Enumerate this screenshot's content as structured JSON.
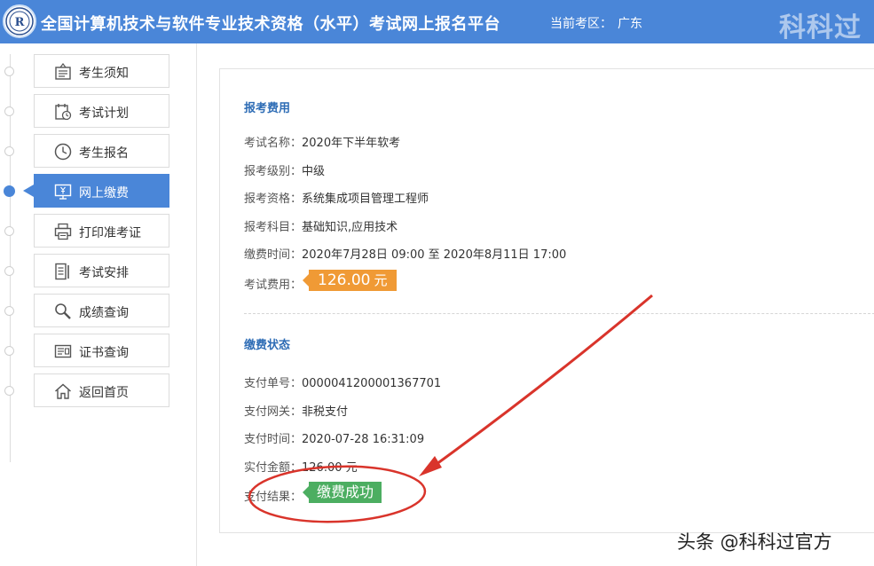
{
  "header": {
    "title": "全国计算机技术与软件专业技术资格（水平）考试网上报名平台",
    "region_label": "当前考区：",
    "region_value": "广东",
    "watermark": "科科过"
  },
  "sidebar": {
    "items": [
      {
        "label": "考生须知",
        "icon": "notice-board-icon",
        "active": false
      },
      {
        "label": "考试计划",
        "icon": "calendar-clock-icon",
        "active": false
      },
      {
        "label": "考生报名",
        "icon": "clock-icon",
        "active": false
      },
      {
        "label": "网上缴费",
        "icon": "monitor-yen-icon",
        "active": true
      },
      {
        "label": "打印准考证",
        "icon": "printer-icon",
        "active": false
      },
      {
        "label": "考试安排",
        "icon": "document-list-icon",
        "active": false
      },
      {
        "label": "成绩查询",
        "icon": "magnifier-icon",
        "active": false
      },
      {
        "label": "证书查询",
        "icon": "certificate-icon",
        "active": false
      },
      {
        "label": "返回首页",
        "icon": "home-icon",
        "active": false
      }
    ]
  },
  "fees": {
    "title": "报考费用",
    "exam_name_label": "考试名称：",
    "exam_name": "2020年下半年软考",
    "level_label": "报考级别：",
    "level": "中级",
    "qualification_label": "报考资格：",
    "qualification": "系统集成项目管理工程师",
    "subjects_label": "报考科目：",
    "subjects": "基础知识,应用技术",
    "period_label": "缴费时间：",
    "period": "2020年7月28日 09:00 至 2020年8月11日 17:00",
    "fee_label": "考试费用：",
    "fee_amount": "126.00",
    "fee_unit": "元"
  },
  "payment": {
    "title": "缴费状态",
    "order_label": "支付单号：",
    "order_no": "0000041200001367701",
    "gateway_label": "支付网关：",
    "gateway": "非税支付",
    "time_label": "支付时间：",
    "time": "2020-07-28 16:31:09",
    "amount_label": "实付金额：",
    "amount": "126.00 元",
    "result_label": "支付结果：",
    "result": "缴费成功"
  },
  "watermark_bottom": "头条 @科科过官方",
  "colors": {
    "header_bg": "#4a86d8",
    "fee_badge": "#f09a35",
    "success_badge": "#4cae61",
    "annotation_red": "#d9342b",
    "section_title": "#2d6cb5"
  }
}
